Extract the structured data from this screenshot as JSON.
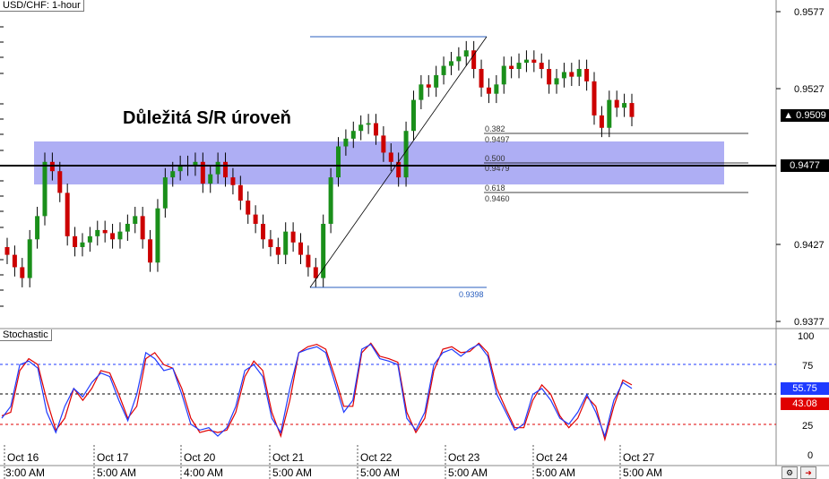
{
  "chart_title": "USD/CHF: 1-hour",
  "heading": "Důležitá S/R úroveň",
  "price_labels": [
    "0.9577",
    "0.9527",
    "0.9427",
    "0.9377"
  ],
  "price_tag_current": "0.9509",
  "price_tag_level": "0.9477",
  "indicator_title": "Stochastic",
  "stoch_levels": [
    "100",
    "75",
    "25",
    "0"
  ],
  "stoch_tag_k": "55.75",
  "stoch_tag_d": "43.08",
  "time_dates": [
    "Oct 16",
    "Oct 17",
    "Oct 20",
    "Oct 21",
    "Oct 22",
    "Oct 23",
    "Oct 24",
    "Oct 27"
  ],
  "time_hours": [
    "3:00 AM",
    "5:00 AM",
    "4:00 AM",
    "5:00 AM",
    "5:00 AM",
    "5:00 AM",
    "5:00 AM",
    "5:00 AM"
  ],
  "fib_labels": {
    "ratio_382": "0.382",
    "price_382": "0.9497",
    "ratio_500": "0.500",
    "price_500": "0.9479",
    "ratio_618": "0.618",
    "price_618": "0.9460",
    "low_price": "0.9398"
  },
  "colors": {
    "bull": "#1a8f1a",
    "bear": "#cc0000",
    "sr_band": "#8c8cf0",
    "fib_line": "#2a5fbf",
    "stoch_k": "#1f3bff",
    "stoch_d": "#e00000"
  },
  "chart_data": {
    "type": "candlestick",
    "title": "USD/CHF: 1-hour",
    "y_range": [
      0.9377,
      0.959
    ],
    "support_resistance_zone": [
      0.9468,
      0.9491
    ],
    "horizontal_level": 0.9477,
    "fibonacci": {
      "high": 0.9557,
      "low": 0.9398,
      "levels": {
        "0.382": 0.9497,
        "0.500": 0.9479,
        "0.618": 0.946
      }
    },
    "close_series": [
      0.942,
      0.9412,
      0.9405,
      0.943,
      0.9445,
      0.948,
      0.9474,
      0.946,
      0.9432,
      0.9425,
      0.9428,
      0.9432,
      0.9436,
      0.9434,
      0.943,
      0.9435,
      0.944,
      0.9445,
      0.943,
      0.9415,
      0.945,
      0.947,
      0.9474,
      0.9478,
      0.9477,
      0.948,
      0.9466,
      0.9472,
      0.948,
      0.947,
      0.9465,
      0.9455,
      0.9446,
      0.944,
      0.943,
      0.9425,
      0.942,
      0.9435,
      0.9428,
      0.942,
      0.9412,
      0.9405,
      0.944,
      0.947,
      0.949,
      0.9495,
      0.95,
      0.9504,
      0.9505,
      0.9497,
      0.9486,
      0.948,
      0.947,
      0.95,
      0.952,
      0.953,
      0.9528,
      0.9536,
      0.9542,
      0.9545,
      0.9548,
      0.9552,
      0.954,
      0.9528,
      0.9524,
      0.953,
      0.9542,
      0.954,
      0.9544,
      0.9546,
      0.9544,
      0.954,
      0.953,
      0.9534,
      0.9538,
      0.9535,
      0.954,
      0.9532,
      0.951,
      0.9502,
      0.952,
      0.9515,
      0.9518,
      0.9509
    ],
    "stochastic": {
      "k": [
        30,
        40,
        75,
        78,
        72,
        35,
        18,
        40,
        55,
        48,
        60,
        68,
        65,
        45,
        28,
        50,
        85,
        80,
        70,
        72,
        50,
        25,
        20,
        22,
        15,
        22,
        40,
        70,
        75,
        65,
        30,
        18,
        55,
        85,
        88,
        90,
        85,
        60,
        35,
        45,
        88,
        92,
        80,
        78,
        75,
        30,
        20,
        35,
        75,
        85,
        88,
        82,
        88,
        92,
        82,
        50,
        35,
        20,
        25,
        50,
        55,
        45,
        30,
        25,
        35,
        50,
        35,
        15,
        45,
        60,
        55
      ],
      "d": [
        32,
        35,
        70,
        80,
        75,
        45,
        20,
        30,
        55,
        45,
        55,
        70,
        68,
        50,
        30,
        40,
        80,
        85,
        75,
        72,
        55,
        30,
        18,
        20,
        18,
        20,
        35,
        65,
        78,
        70,
        35,
        15,
        45,
        85,
        90,
        92,
        88,
        65,
        40,
        40,
        85,
        93,
        82,
        80,
        77,
        35,
        18,
        30,
        70,
        88,
        90,
        85,
        86,
        93,
        85,
        55,
        38,
        22,
        22,
        45,
        58,
        50,
        32,
        22,
        30,
        48,
        40,
        12,
        40,
        62,
        58
      ]
    }
  }
}
